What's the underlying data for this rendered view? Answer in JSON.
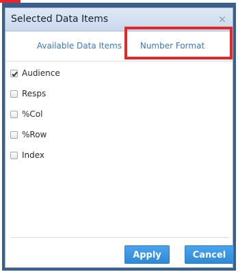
{
  "dialog": {
    "title": "Selected Data Items",
    "close_glyph": "×"
  },
  "tabs": [
    {
      "label": "Available Data Items",
      "active": false
    },
    {
      "label": "Number Format",
      "active": false,
      "highlighted": true
    }
  ],
  "data_items": [
    {
      "label": "Audience",
      "checked": true
    },
    {
      "label": "Resps",
      "checked": false
    },
    {
      "label": "%Col",
      "checked": false
    },
    {
      "label": "%Row",
      "checked": false
    },
    {
      "label": "Index",
      "checked": false
    }
  ],
  "buttons": {
    "apply": "Apply",
    "cancel": "Cancel"
  },
  "colors": {
    "highlight": "#e8262a",
    "tab_text": "#3a7ab8",
    "button": "#2f8ad6"
  }
}
